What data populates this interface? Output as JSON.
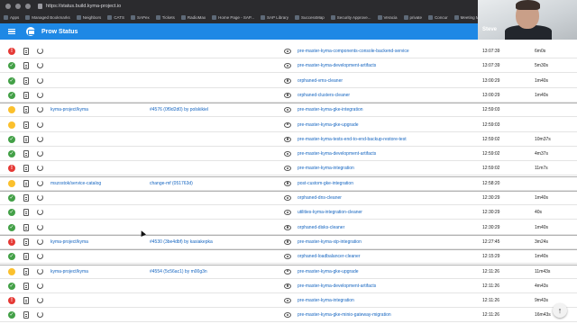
{
  "browser": {
    "url": "https://status.build.kyma-project.io",
    "bookmarks": [
      "Apps",
      "Managed Bookmarks",
      "Neighbors",
      "CATS",
      "SAPex",
      "Tickets",
      "RadioMax",
      "Home Page - SAP...",
      "SAP Library",
      "SuccessMap",
      "Security Approve...",
      "Veracia",
      "private",
      "Concur",
      "Meeting Mini..."
    ]
  },
  "webcam": {
    "name": "Steve"
  },
  "appbar": {
    "title": "Prow Status"
  },
  "colors": {
    "success": "#43a047",
    "failure": "#e53935",
    "pending": "#fbc02d",
    "link": "#1565c0",
    "appbar": "#1e88e5"
  },
  "state_icons": {
    "success": "✓",
    "failure": "!",
    "pending": ""
  },
  "rows": [
    {
      "state": "failure",
      "repo": "",
      "pr": "",
      "job": "pre-master-kyma-components-console-backend-service",
      "time": "13:07:39",
      "duration": "6m0s"
    },
    {
      "state": "success",
      "repo": "",
      "pr": "",
      "job": "pre-master-kyma-development-artifacts",
      "time": "13:07:39",
      "duration": "5m30s"
    },
    {
      "state": "success",
      "repo": "",
      "pr": "",
      "job": "orphaned-vms-cleaner",
      "time": "13:00:29",
      "duration": "1m40s"
    },
    {
      "state": "success",
      "repo": "",
      "pr": "",
      "job": "orphaned-clusters-cleaner",
      "time": "13:00:29",
      "duration": "1m40s"
    },
    {
      "state": "pending",
      "repo": "kyma-project/kyma",
      "pr": "#4576 (0f9d2d0) by polskikiel",
      "job": "pre-master-kyma-gke-integration",
      "time": "12:59:03",
      "duration": ""
    },
    {
      "state": "pending",
      "repo": "",
      "pr": "",
      "job": "pre-master-kyma-gke-upgrade",
      "time": "12:59:03",
      "duration": ""
    },
    {
      "state": "success",
      "repo": "",
      "pr": "",
      "job": "pre-master-kyma-tests-end-to-end-backup-restore-test",
      "time": "12:59:02",
      "duration": "10m37s"
    },
    {
      "state": "success",
      "repo": "",
      "pr": "",
      "job": "pre-master-kyma-development-artifacts",
      "time": "12:59:02",
      "duration": "4m37s"
    },
    {
      "state": "failure",
      "repo": "",
      "pr": "",
      "job": "pre-master-kyma-integration",
      "time": "12:59:02",
      "duration": "11m7s"
    },
    {
      "state": "pending",
      "repo": "mszostok/service-catalog",
      "pr": "change-mf (051763d)",
      "job": "post-custom-gke-integration",
      "time": "12:58:20",
      "duration": ""
    },
    {
      "state": "success",
      "repo": "",
      "pr": "",
      "job": "orphaned-dns-cleaner",
      "time": "12:30:29",
      "duration": "1m40s"
    },
    {
      "state": "success",
      "repo": "",
      "pr": "",
      "job": "utilities-kyma-integration-cleaner",
      "time": "12:30:29",
      "duration": "40s"
    },
    {
      "state": "success",
      "repo": "",
      "pr": "",
      "job": "orphaned-disks-cleaner",
      "time": "12:30:29",
      "duration": "1m40s"
    },
    {
      "state": "failure",
      "repo": "kyma-project/kyma",
      "pr": "#4530 (3be4dbf) by kasiakepka",
      "job": "pre-master-kyma-xip-integration",
      "time": "12:27:45",
      "duration": "3m24s"
    },
    {
      "state": "success",
      "repo": "",
      "pr": "",
      "job": "orphaned-loadbalancer-cleaner",
      "time": "12:15:29",
      "duration": "1m40s"
    },
    {
      "state": "pending",
      "repo": "kyma-project/kyma",
      "pr": "#4554 (5c56ac1) by m00g3n",
      "job": "pre-master-kyma-gke-upgrade",
      "time": "12:11:26",
      "duration": "11m43s"
    },
    {
      "state": "success",
      "repo": "",
      "pr": "",
      "job": "pre-master-kyma-development-artifacts",
      "time": "12:11:26",
      "duration": "4m43s"
    },
    {
      "state": "failure",
      "repo": "",
      "pr": "",
      "job": "pre-master-kyma-integration",
      "time": "12:11:26",
      "duration": "9m43s"
    },
    {
      "state": "success",
      "repo": "",
      "pr": "",
      "job": "pre-master-kyma-gke-minio-gateway-migration",
      "time": "12:11:26",
      "duration": "16m43s"
    }
  ],
  "group_starts": [
    4,
    9,
    10,
    13,
    14,
    15
  ],
  "scroll_top": {
    "icon": "↑"
  }
}
